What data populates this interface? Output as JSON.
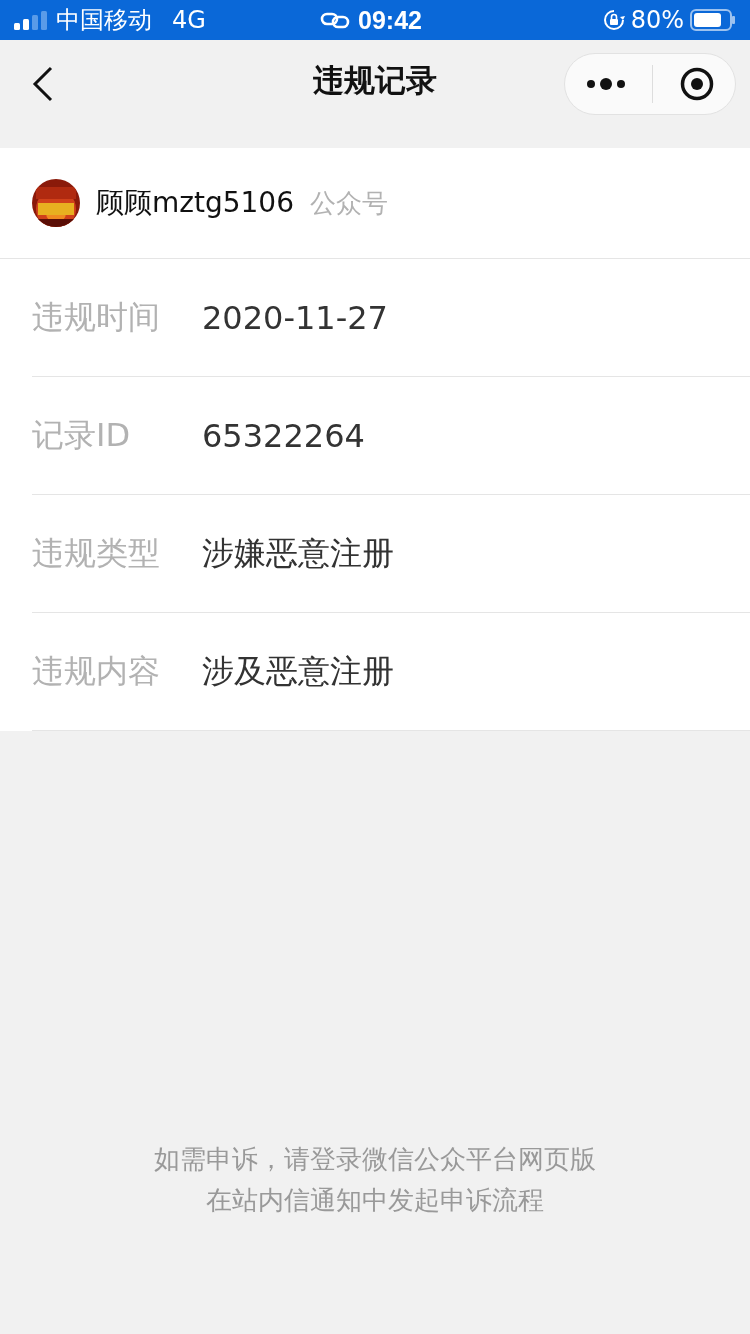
{
  "status_bar": {
    "carrier": "中国移动",
    "network": "4G",
    "time": "09:42",
    "battery": "80%"
  },
  "nav": {
    "title": "违规记录"
  },
  "account": {
    "name": "顾顾mztg5106",
    "type": "公众号"
  },
  "fields": [
    {
      "label": "违规时间",
      "value": "2020-11-27"
    },
    {
      "label": "记录ID",
      "value": "65322264"
    },
    {
      "label": "违规类型",
      "value": "涉嫌恶意注册"
    },
    {
      "label": "违规内容",
      "value": "涉及恶意注册"
    }
  ],
  "notice": [
    "如需申诉，请登录微信公众平台网页版",
    "在站内信通知中发起申诉流程"
  ]
}
